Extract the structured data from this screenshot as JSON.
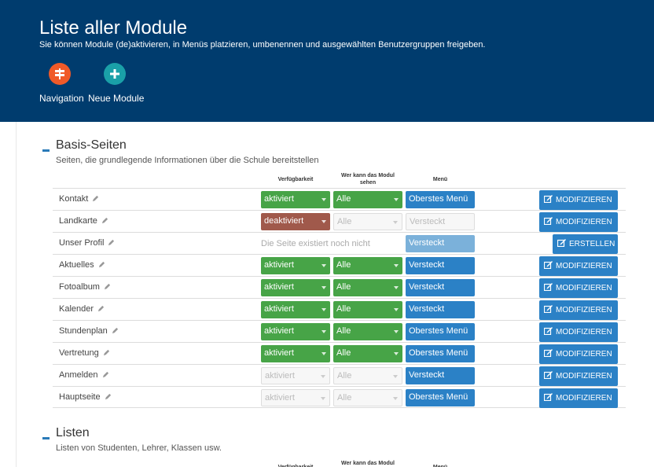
{
  "header": {
    "title": "Liste aller Module",
    "subtitle": "Sie können Module (de)aktivieren, in Menüs platzieren, umbenennen und ausgewählten Benutzergruppen freigeben.",
    "buttons": [
      {
        "label": "Navigation",
        "icon": "signpost-icon",
        "color": "#f05a28"
      },
      {
        "label": "Neue Module",
        "icon": "plus-icon",
        "color": "#1aa0a8"
      }
    ]
  },
  "columns": {
    "availability": "Verfügbarkeit",
    "visibility": "Wer kann das Modul sehen",
    "menu": "Menü"
  },
  "sections": [
    {
      "title": "Basis-Seiten",
      "description": "Seiten, die grundlegende Informationen über die Schule bereitstellen",
      "rows": [
        {
          "name": "Kontakt",
          "availability": "aktiviert",
          "visibility": "Alle",
          "menu": "Oberstes Menü",
          "action": "MODIFIZIEREN"
        },
        {
          "name": "Landkarte",
          "availability": "deaktiviert",
          "visibility": "Alle",
          "menu": "Versteckt",
          "action": "MODIFIZIEREN"
        },
        {
          "name": "Unser Profil",
          "status_text": "Die Seite existiert noch nicht",
          "menu": "Versteckt",
          "action": "ERSTELLEN"
        },
        {
          "name": "Aktuelles",
          "availability": "aktiviert",
          "visibility": "Alle",
          "menu": "Versteckt",
          "action": "MODIFIZIEREN"
        },
        {
          "name": "Fotoalbum",
          "availability": "aktiviert",
          "visibility": "Alle",
          "menu": "Versteckt",
          "action": "MODIFIZIEREN"
        },
        {
          "name": "Kalender",
          "availability": "aktiviert",
          "visibility": "Alle",
          "menu": "Versteckt",
          "action": "MODIFIZIEREN"
        },
        {
          "name": "Stundenplan",
          "availability": "aktiviert",
          "visibility": "Alle",
          "menu": "Oberstes Menü",
          "action": "MODIFIZIEREN"
        },
        {
          "name": "Vertretung",
          "availability": "aktiviert",
          "visibility": "Alle",
          "menu": "Oberstes Menü",
          "action": "MODIFIZIEREN"
        },
        {
          "name": "Anmelden",
          "availability": "aktiviert",
          "visibility": "Alle",
          "menu": "Versteckt",
          "action": "MODIFIZIEREN"
        },
        {
          "name": "Hauptseite",
          "availability": "aktiviert",
          "visibility": "Alle",
          "menu": "Oberstes Menü",
          "action": "MODIFIZIEREN"
        }
      ]
    },
    {
      "title": "Listen",
      "description": "Listen von Studenten, Lehrer, Klassen usw."
    }
  ],
  "colors": {
    "header_bg": "#003c6e",
    "green": "#47a447",
    "red": "#a0594b",
    "blue": "#2b81c6",
    "light_blue": "#7bb1da"
  }
}
